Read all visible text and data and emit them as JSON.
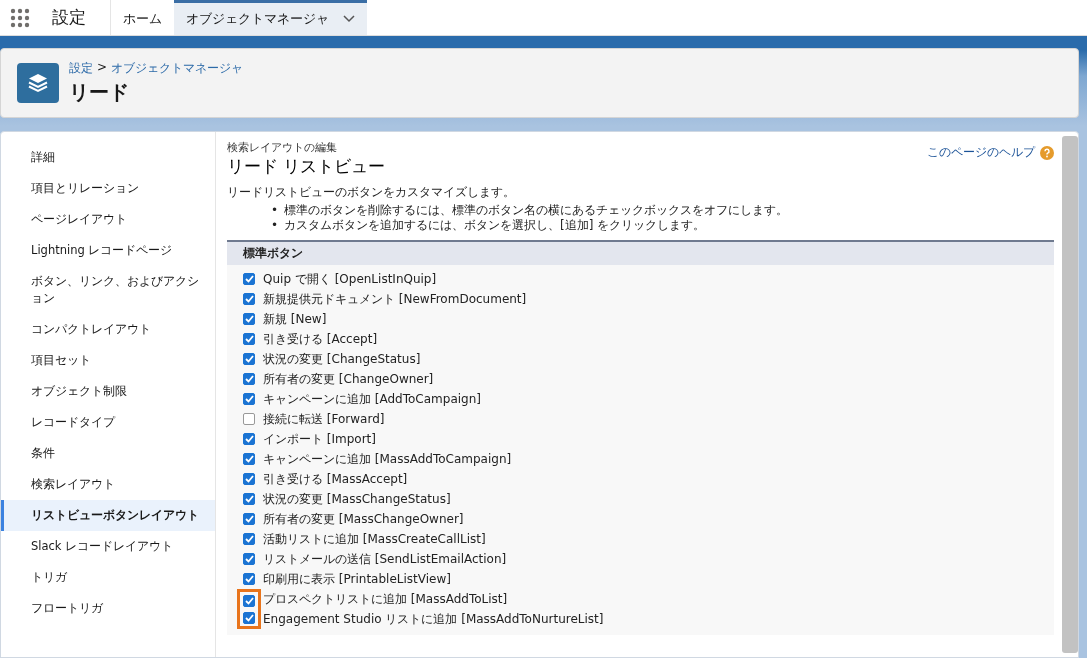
{
  "app_title": "設定",
  "nav_tabs": [
    {
      "label": "ホーム",
      "selected": false,
      "has_menu": false
    },
    {
      "label": "オブジェクトマネージャ",
      "selected": true,
      "has_menu": true
    }
  ],
  "header": {
    "breadcrumb": [
      {
        "label": "設定"
      },
      {
        "label": "オブジェクトマネージャ"
      }
    ],
    "separator": ">",
    "title": "リード"
  },
  "sidebar": {
    "items": [
      {
        "label": "詳細",
        "selected": false
      },
      {
        "label": "項目とリレーション",
        "selected": false
      },
      {
        "label": "ページレイアウト",
        "selected": false
      },
      {
        "label": "Lightning レコードページ",
        "selected": false
      },
      {
        "label": "ボタン、リンク、およびアクション",
        "selected": false
      },
      {
        "label": "コンパクトレイアウト",
        "selected": false
      },
      {
        "label": "項目セット",
        "selected": false
      },
      {
        "label": "オブジェクト制限",
        "selected": false
      },
      {
        "label": "レコードタイプ",
        "selected": false
      },
      {
        "label": "条件",
        "selected": false
      },
      {
        "label": "検索レイアウト",
        "selected": false
      },
      {
        "label": "リストビューボタンレイアウト",
        "selected": true
      },
      {
        "label": "Slack レコードレイアウト",
        "selected": false
      },
      {
        "label": "トリガ",
        "selected": false
      },
      {
        "label": "フロートリガ",
        "selected": false
      }
    ]
  },
  "content": {
    "subtitle": "検索レイアウトの編集",
    "title": "リード リストビュー",
    "help_link": "このページのヘルプ",
    "description": "リードリストビューのボタンをカスタマイズします。",
    "bullet_marker": "•",
    "bullets": [
      "標準のボタンを削除するには、標準のボタン名の横にあるチェックボックスをオフにします。",
      "カスタムボタンを追加するには、ボタンを選択し、[追加] をクリックします。"
    ],
    "section": {
      "title": "標準ボタン",
      "buttons": [
        {
          "label": "Quip で開く [OpenListInQuip]",
          "checked": true,
          "highlighted": false
        },
        {
          "label": "新規提供元ドキュメント [NewFromDocument]",
          "checked": true,
          "highlighted": false
        },
        {
          "label": "新規 [New]",
          "checked": true,
          "highlighted": false
        },
        {
          "label": "引き受ける [Accept]",
          "checked": true,
          "highlighted": false
        },
        {
          "label": "状況の変更 [ChangeStatus]",
          "checked": true,
          "highlighted": false
        },
        {
          "label": "所有者の変更 [ChangeOwner]",
          "checked": true,
          "highlighted": false
        },
        {
          "label": "キャンペーンに追加 [AddToCampaign]",
          "checked": true,
          "highlighted": false
        },
        {
          "label": "接続に転送 [Forward]",
          "checked": false,
          "highlighted": false
        },
        {
          "label": "インポート [Import]",
          "checked": true,
          "highlighted": false
        },
        {
          "label": "キャンペーンに追加 [MassAddToCampaign]",
          "checked": true,
          "highlighted": false
        },
        {
          "label": "引き受ける [MassAccept]",
          "checked": true,
          "highlighted": false
        },
        {
          "label": "状況の変更 [MassChangeStatus]",
          "checked": true,
          "highlighted": false
        },
        {
          "label": "所有者の変更 [MassChangeOwner]",
          "checked": true,
          "highlighted": false
        },
        {
          "label": "活動リストに追加 [MassCreateCallList]",
          "checked": true,
          "highlighted": false
        },
        {
          "label": "リストメールの送信 [SendListEmailAction]",
          "checked": true,
          "highlighted": false
        },
        {
          "label": "印刷用に表示 [PrintableListView]",
          "checked": true,
          "highlighted": false
        },
        {
          "label": "プロスペクトリストに追加 [MassAddToList]",
          "checked": true,
          "highlighted": true
        },
        {
          "label": "Engagement Studio リストに追加 [MassAddToNurtureList]",
          "checked": true,
          "highlighted": true
        }
      ]
    }
  }
}
